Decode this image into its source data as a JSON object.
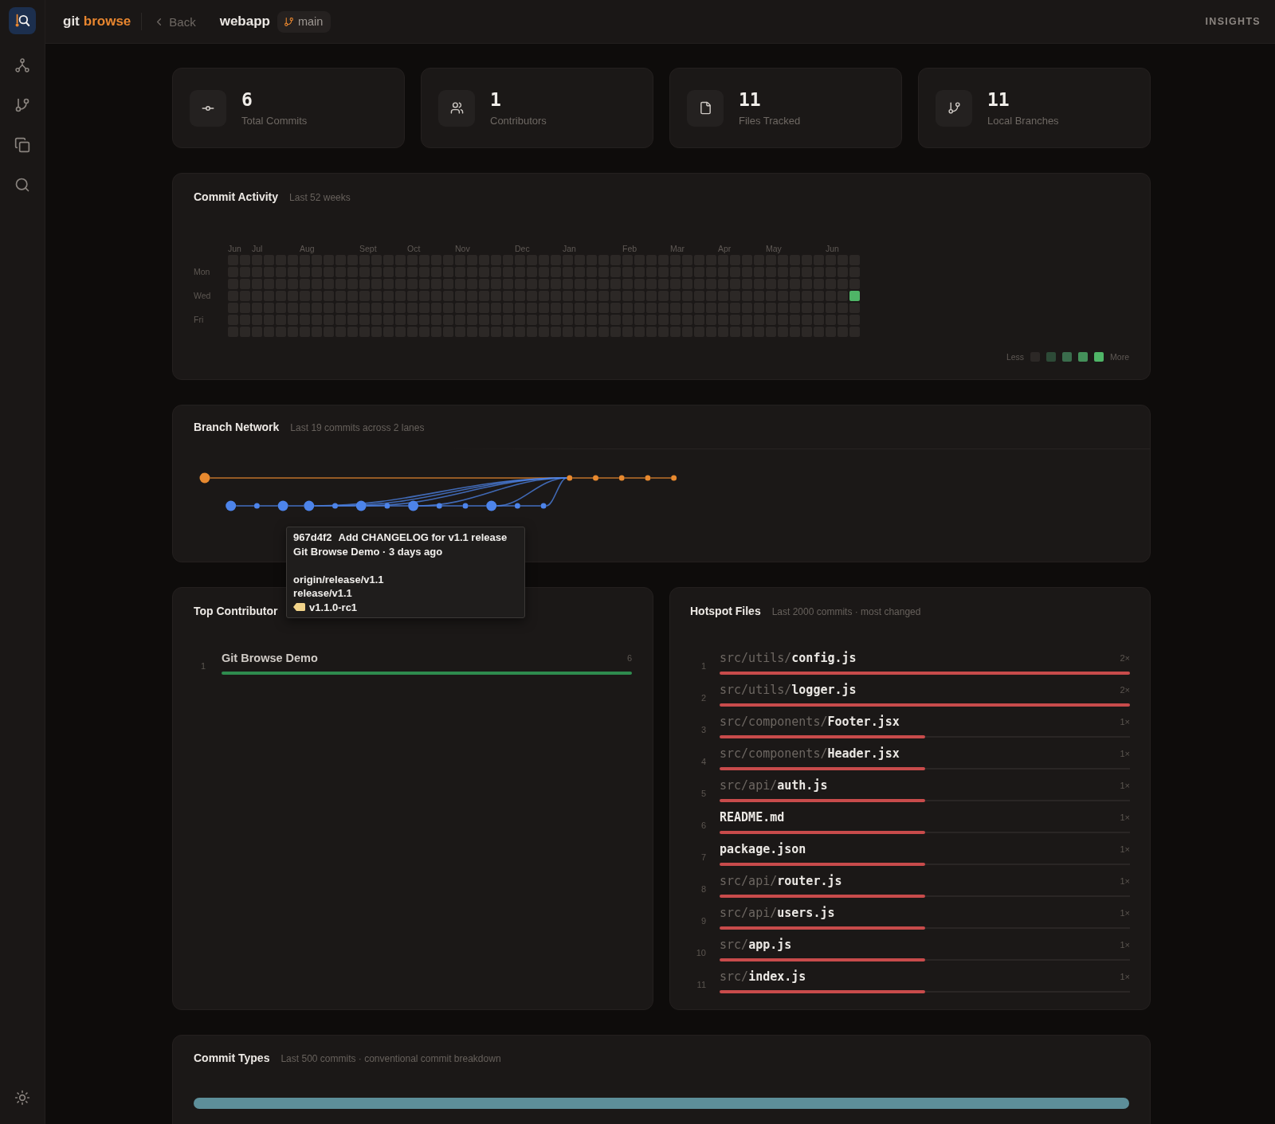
{
  "top_bar": {
    "brand": {
      "text": "git",
      "accent": "browse"
    },
    "back": "Back",
    "repo": "webapp",
    "branch": "main",
    "section": "INSIGHTS"
  },
  "stats": [
    {
      "kind": "commits",
      "value": "6",
      "label": "Total Commits"
    },
    {
      "kind": "contributors",
      "value": "1",
      "label": "Contributors"
    },
    {
      "kind": "files",
      "value": "11",
      "label": "Files Tracked"
    },
    {
      "kind": "branches",
      "value": "11",
      "label": "Local Branches"
    }
  ],
  "activity": {
    "title": "Commit Activity",
    "subtitle": "Last 52 weeks",
    "day_labels": [
      "Mon",
      "Wed",
      "Fri"
    ],
    "legend": {
      "less": "Less",
      "more": "More"
    },
    "weeks": [
      {
        "month": "Jun",
        "days": [
          {
            "active": false
          },
          {
            "active": false
          },
          {
            "active": false
          },
          {
            "active": false
          },
          {
            "active": false
          },
          {
            "active": false
          },
          {
            "active": false
          }
        ]
      },
      {
        "days": [
          {
            "active": false
          },
          {
            "active": false
          },
          {
            "active": false
          },
          {
            "active": false
          },
          {
            "active": false
          },
          {
            "active": false
          },
          {
            "active": false
          }
        ]
      },
      {
        "month": "Jul",
        "days": [
          {
            "active": false
          },
          {
            "active": false
          },
          {
            "active": false
          },
          {
            "active": false
          },
          {
            "active": false
          },
          {
            "active": false
          },
          {
            "active": false
          }
        ]
      },
      {
        "days": [
          {
            "active": false
          },
          {
            "active": false
          },
          {
            "active": false
          },
          {
            "active": false
          },
          {
            "active": false
          },
          {
            "active": false
          },
          {
            "active": false
          }
        ]
      },
      {
        "days": [
          {
            "active": false
          },
          {
            "active": false
          },
          {
            "active": false
          },
          {
            "active": false
          },
          {
            "active": false
          },
          {
            "active": false
          },
          {
            "active": false
          }
        ]
      },
      {
        "days": [
          {
            "active": false
          },
          {
            "active": false
          },
          {
            "active": false
          },
          {
            "active": false
          },
          {
            "active": false
          },
          {
            "active": false
          },
          {
            "active": false
          }
        ]
      },
      {
        "month": "Aug",
        "days": [
          {
            "active": false
          },
          {
            "active": false
          },
          {
            "active": false
          },
          {
            "active": false
          },
          {
            "active": false
          },
          {
            "active": false
          },
          {
            "active": false
          }
        ]
      },
      {
        "days": [
          {
            "active": false
          },
          {
            "active": false
          },
          {
            "active": false
          },
          {
            "active": false
          },
          {
            "active": false
          },
          {
            "active": false
          },
          {
            "active": false
          }
        ]
      },
      {
        "days": [
          {
            "active": false
          },
          {
            "active": false
          },
          {
            "active": false
          },
          {
            "active": false
          },
          {
            "active": false
          },
          {
            "active": false
          },
          {
            "active": false
          }
        ]
      },
      {
        "days": [
          {
            "active": false
          },
          {
            "active": false
          },
          {
            "active": false
          },
          {
            "active": false
          },
          {
            "active": false
          },
          {
            "active": false
          },
          {
            "active": false
          }
        ]
      },
      {
        "days": [
          {
            "active": false
          },
          {
            "active": false
          },
          {
            "active": false
          },
          {
            "active": false
          },
          {
            "active": false
          },
          {
            "active": false
          },
          {
            "active": false
          }
        ]
      },
      {
        "month": "Sept",
        "days": [
          {
            "active": false
          },
          {
            "active": false
          },
          {
            "active": false
          },
          {
            "active": false
          },
          {
            "active": false
          },
          {
            "active": false
          },
          {
            "active": false
          }
        ]
      },
      {
        "days": [
          {
            "active": false
          },
          {
            "active": false
          },
          {
            "active": false
          },
          {
            "active": false
          },
          {
            "active": false
          },
          {
            "active": false
          },
          {
            "active": false
          }
        ]
      },
      {
        "days": [
          {
            "active": false
          },
          {
            "active": false
          },
          {
            "active": false
          },
          {
            "active": false
          },
          {
            "active": false
          },
          {
            "active": false
          },
          {
            "active": false
          }
        ]
      },
      {
        "days": [
          {
            "active": false
          },
          {
            "active": false
          },
          {
            "active": false
          },
          {
            "active": false
          },
          {
            "active": false
          },
          {
            "active": false
          },
          {
            "active": false
          }
        ]
      },
      {
        "month": "Oct",
        "days": [
          {
            "active": false
          },
          {
            "active": false
          },
          {
            "active": false
          },
          {
            "active": false
          },
          {
            "active": false
          },
          {
            "active": false
          },
          {
            "active": false
          }
        ]
      },
      {
        "days": [
          {
            "active": false
          },
          {
            "active": false
          },
          {
            "active": false
          },
          {
            "active": false
          },
          {
            "active": false
          },
          {
            "active": false
          },
          {
            "active": false
          }
        ]
      },
      {
        "days": [
          {
            "active": false
          },
          {
            "active": false
          },
          {
            "active": false
          },
          {
            "active": false
          },
          {
            "active": false
          },
          {
            "active": false
          },
          {
            "active": false
          }
        ]
      },
      {
        "days": [
          {
            "active": false
          },
          {
            "active": false
          },
          {
            "active": false
          },
          {
            "active": false
          },
          {
            "active": false
          },
          {
            "active": false
          },
          {
            "active": false
          }
        ]
      },
      {
        "month": "Nov",
        "days": [
          {
            "active": false
          },
          {
            "active": false
          },
          {
            "active": false
          },
          {
            "active": false
          },
          {
            "active": false
          },
          {
            "active": false
          },
          {
            "active": false
          }
        ]
      },
      {
        "days": [
          {
            "active": false
          },
          {
            "active": false
          },
          {
            "active": false
          },
          {
            "active": false
          },
          {
            "active": false
          },
          {
            "active": false
          },
          {
            "active": false
          }
        ]
      },
      {
        "days": [
          {
            "active": false
          },
          {
            "active": false
          },
          {
            "active": false
          },
          {
            "active": false
          },
          {
            "active": false
          },
          {
            "active": false
          },
          {
            "active": false
          }
        ]
      },
      {
        "days": [
          {
            "active": false
          },
          {
            "active": false
          },
          {
            "active": false
          },
          {
            "active": false
          },
          {
            "active": false
          },
          {
            "active": false
          },
          {
            "active": false
          }
        ]
      },
      {
        "days": [
          {
            "active": false
          },
          {
            "active": false
          },
          {
            "active": false
          },
          {
            "active": false
          },
          {
            "active": false
          },
          {
            "active": false
          },
          {
            "active": false
          }
        ]
      },
      {
        "month": "Dec",
        "days": [
          {
            "active": false
          },
          {
            "active": false
          },
          {
            "active": false
          },
          {
            "active": false
          },
          {
            "active": false
          },
          {
            "active": false
          },
          {
            "active": false
          }
        ]
      },
      {
        "days": [
          {
            "active": false
          },
          {
            "active": false
          },
          {
            "active": false
          },
          {
            "active": false
          },
          {
            "active": false
          },
          {
            "active": false
          },
          {
            "active": false
          }
        ]
      },
      {
        "days": [
          {
            "active": false
          },
          {
            "active": false
          },
          {
            "active": false
          },
          {
            "active": false
          },
          {
            "active": false
          },
          {
            "active": false
          },
          {
            "active": false
          }
        ]
      },
      {
        "days": [
          {
            "active": false
          },
          {
            "active": false
          },
          {
            "active": false
          },
          {
            "active": false
          },
          {
            "active": false
          },
          {
            "active": false
          },
          {
            "active": false
          }
        ]
      },
      {
        "month": "Jan",
        "days": [
          {
            "active": false
          },
          {
            "active": false
          },
          {
            "active": false
          },
          {
            "active": false
          },
          {
            "active": false
          },
          {
            "active": false
          },
          {
            "active": false
          }
        ]
      },
      {
        "days": [
          {
            "active": false
          },
          {
            "active": false
          },
          {
            "active": false
          },
          {
            "active": false
          },
          {
            "active": false
          },
          {
            "active": false
          },
          {
            "active": false
          }
        ]
      },
      {
        "days": [
          {
            "active": false
          },
          {
            "active": false
          },
          {
            "active": false
          },
          {
            "active": false
          },
          {
            "active": false
          },
          {
            "active": false
          },
          {
            "active": false
          }
        ]
      },
      {
        "days": [
          {
            "active": false
          },
          {
            "active": false
          },
          {
            "active": false
          },
          {
            "active": false
          },
          {
            "active": false
          },
          {
            "active": false
          },
          {
            "active": false
          }
        ]
      },
      {
        "days": [
          {
            "active": false
          },
          {
            "active": false
          },
          {
            "active": false
          },
          {
            "active": false
          },
          {
            "active": false
          },
          {
            "active": false
          },
          {
            "active": false
          }
        ]
      },
      {
        "month": "Feb",
        "days": [
          {
            "active": false
          },
          {
            "active": false
          },
          {
            "active": false
          },
          {
            "active": false
          },
          {
            "active": false
          },
          {
            "active": false
          },
          {
            "active": false
          }
        ]
      },
      {
        "days": [
          {
            "active": false
          },
          {
            "active": false
          },
          {
            "active": false
          },
          {
            "active": false
          },
          {
            "active": false
          },
          {
            "active": false
          },
          {
            "active": false
          }
        ]
      },
      {
        "days": [
          {
            "active": false
          },
          {
            "active": false
          },
          {
            "active": false
          },
          {
            "active": false
          },
          {
            "active": false
          },
          {
            "active": false
          },
          {
            "active": false
          }
        ]
      },
      {
        "days": [
          {
            "active": false
          },
          {
            "active": false
          },
          {
            "active": false
          },
          {
            "active": false
          },
          {
            "active": false
          },
          {
            "active": false
          },
          {
            "active": false
          }
        ]
      },
      {
        "month": "Mar",
        "days": [
          {
            "active": false
          },
          {
            "active": false
          },
          {
            "active": false
          },
          {
            "active": false
          },
          {
            "active": false
          },
          {
            "active": false
          },
          {
            "active": false
          }
        ]
      },
      {
        "days": [
          {
            "active": false
          },
          {
            "active": false
          },
          {
            "active": false
          },
          {
            "active": false
          },
          {
            "active": false
          },
          {
            "active": false
          },
          {
            "active": false
          }
        ]
      },
      {
        "days": [
          {
            "active": false
          },
          {
            "active": false
          },
          {
            "active": false
          },
          {
            "active": false
          },
          {
            "active": false
          },
          {
            "active": false
          },
          {
            "active": false
          }
        ]
      },
      {
        "days": [
          {
            "active": false
          },
          {
            "active": false
          },
          {
            "active": false
          },
          {
            "active": false
          },
          {
            "active": false
          },
          {
            "active": false
          },
          {
            "active": false
          }
        ]
      },
      {
        "month": "Apr",
        "days": [
          {
            "active": false
          },
          {
            "active": false
          },
          {
            "active": false
          },
          {
            "active": false
          },
          {
            "active": false
          },
          {
            "active": false
          },
          {
            "active": false
          }
        ]
      },
      {
        "days": [
          {
            "active": false
          },
          {
            "active": false
          },
          {
            "active": false
          },
          {
            "active": false
          },
          {
            "active": false
          },
          {
            "active": false
          },
          {
            "active": false
          }
        ]
      },
      {
        "days": [
          {
            "active": false
          },
          {
            "active": false
          },
          {
            "active": false
          },
          {
            "active": false
          },
          {
            "active": false
          },
          {
            "active": false
          },
          {
            "active": false
          }
        ]
      },
      {
        "days": [
          {
            "active": false
          },
          {
            "active": false
          },
          {
            "active": false
          },
          {
            "active": false
          },
          {
            "active": false
          },
          {
            "active": false
          },
          {
            "active": false
          }
        ]
      },
      {
        "month": "May",
        "days": [
          {
            "active": false
          },
          {
            "active": false
          },
          {
            "active": false
          },
          {
            "active": false
          },
          {
            "active": false
          },
          {
            "active": false
          },
          {
            "active": false
          }
        ]
      },
      {
        "days": [
          {
            "active": false
          },
          {
            "active": false
          },
          {
            "active": false
          },
          {
            "active": false
          },
          {
            "active": false
          },
          {
            "active": false
          },
          {
            "active": false
          }
        ]
      },
      {
        "days": [
          {
            "active": false
          },
          {
            "active": false
          },
          {
            "active": false
          },
          {
            "active": false
          },
          {
            "active": false
          },
          {
            "active": false
          },
          {
            "active": false
          }
        ]
      },
      {
        "days": [
          {
            "active": false
          },
          {
            "active": false
          },
          {
            "active": false
          },
          {
            "active": false
          },
          {
            "active": false
          },
          {
            "active": false
          },
          {
            "active": false
          }
        ]
      },
      {
        "days": [
          {
            "active": false
          },
          {
            "active": false
          },
          {
            "active": false
          },
          {
            "active": false
          },
          {
            "active": false
          },
          {
            "active": false
          },
          {
            "active": false
          }
        ]
      },
      {
        "month": "Jun",
        "days": [
          {
            "active": false
          },
          {
            "active": false
          },
          {
            "active": false
          },
          {
            "active": false
          },
          {
            "active": false
          },
          {
            "active": false
          },
          {
            "active": false
          }
        ]
      },
      {
        "days": [
          {
            "active": false
          },
          {
            "active": false
          },
          {
            "active": false
          },
          {
            "active": false
          },
          {
            "active": false
          },
          {
            "active": false
          },
          {
            "active": false
          }
        ]
      },
      {
        "days": [
          {
            "active": false
          },
          {
            "active": false
          },
          {
            "active": false
          },
          {
            "active": true
          },
          {
            "active": false
          },
          {
            "active": false
          },
          {
            "active": false
          }
        ]
      }
    ]
  },
  "branch_network": {
    "title": "Branch Network",
    "subtitle": "Last 19 commits across 2 lanes",
    "commits": [
      {
        "color": "#e8892f",
        "kind": "ref"
      },
      {
        "color": "#4d84ea",
        "kind": "ref"
      },
      {
        "color": "#4d84ea",
        "kind": "commit"
      },
      {
        "color": "#4d84ea",
        "kind": "ref",
        "tooltip": {
          "hash": "967d4f2",
          "message": "Add CHANGELOG for v1.1 release",
          "meta": "Git Browse Demo · 3 days ago",
          "refs": [
            {
              "kind": "branch",
              "name": "origin/release/v1.1"
            },
            {
              "kind": "branch",
              "name": "release/v1.1"
            },
            {
              "kind": "tag",
              "name": "v1.1.0-rc1"
            }
          ]
        }
      },
      {
        "color": "#4d84ea",
        "kind": "ref",
        "link": {
          "kind": "merge"
        }
      },
      {
        "color": "#4d84ea",
        "kind": "commit",
        "link": {
          "kind": "merge"
        }
      },
      {
        "color": "#4d84ea",
        "kind": "ref",
        "link": {
          "kind": "merge"
        }
      },
      {
        "color": "#4d84ea",
        "kind": "commit"
      },
      {
        "color": "#4d84ea",
        "kind": "ref",
        "link": {
          "kind": "merge"
        }
      },
      {
        "color": "#4d84ea",
        "kind": "commit"
      },
      {
        "color": "#4d84ea",
        "kind": "commit"
      },
      {
        "color": "#4d84ea",
        "kind": "ref",
        "link": {
          "kind": "merge"
        }
      },
      {
        "color": "#4d84ea",
        "kind": "commit"
      },
      {
        "color": "#4d84ea",
        "kind": "commit",
        "link": {
          "kind": "merge"
        }
      },
      {
        "color": "#e8892f",
        "kind": "commit"
      },
      {
        "color": "#e8892f",
        "kind": "commit"
      },
      {
        "color": "#e8892f",
        "kind": "commit"
      },
      {
        "color": "#e8892f",
        "kind": "commit"
      },
      {
        "color": "#e8892f",
        "kind": "commit"
      }
    ]
  },
  "top_contributors": {
    "title": "Top Contributor",
    "rows": [
      {
        "rank": "1",
        "name": "Git Browse Demo",
        "count": "6",
        "level": 1
      }
    ]
  },
  "hotspot_files": {
    "title": "Hotspot Files",
    "subtitle": "Last 2000 commits · most changed",
    "rows": [
      {
        "rank": "1",
        "dir": "src/utils/",
        "name": "config.js",
        "count": "2×",
        "level": 1
      },
      {
        "rank": "2",
        "dir": "src/utils/",
        "name": "logger.js",
        "count": "2×",
        "level": 1
      },
      {
        "rank": "3",
        "dir": "src/components/",
        "name": "Footer.jsx",
        "count": "1×",
        "level": 0.5
      },
      {
        "rank": "4",
        "dir": "src/components/",
        "name": "Header.jsx",
        "count": "1×",
        "level": 0.5
      },
      {
        "rank": "5",
        "dir": "src/api/",
        "name": "auth.js",
        "count": "1×",
        "level": 0.5
      },
      {
        "rank": "6",
        "name": "README.md",
        "count": "1×",
        "level": 0.5
      },
      {
        "rank": "7",
        "name": "package.json",
        "count": "1×",
        "level": 0.5
      },
      {
        "rank": "8",
        "dir": "src/api/",
        "name": "router.js",
        "count": "1×",
        "level": 0.5
      },
      {
        "rank": "9",
        "dir": "src/api/",
        "name": "users.js",
        "count": "1×",
        "level": 0.5
      },
      {
        "rank": "10",
        "dir": "src/",
        "name": "app.js",
        "count": "1×",
        "level": 0.5
      },
      {
        "rank": "11",
        "dir": "src/",
        "name": "index.js",
        "count": "1×",
        "level": 0.5
      }
    ]
  },
  "commit_types": {
    "title": "Commit Types",
    "subtitle": "Last 500 commits · conventional commit breakdown",
    "segments": [
      {
        "color": "#5d8e99",
        "level": 1
      }
    ]
  }
}
